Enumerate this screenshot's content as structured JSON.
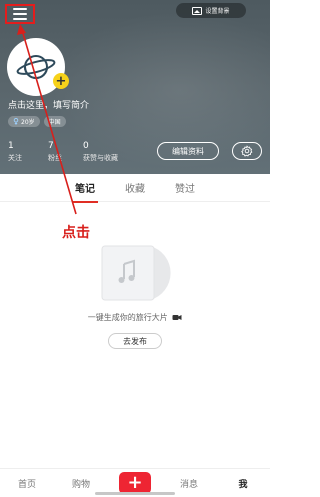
{
  "header": {
    "set_background_label": "设置背景",
    "bio_placeholder": "点击这里，填写简介",
    "tags": [
      {
        "icon": "female-icon",
        "label": "20岁"
      },
      {
        "label": "中国"
      }
    ],
    "stats": [
      {
        "num": "1",
        "label": "关注"
      },
      {
        "num": "7",
        "label": "粉丝"
      },
      {
        "num": "0",
        "label": "获赞与收藏"
      }
    ],
    "edit_profile_label": "编辑资料"
  },
  "tabs": [
    {
      "label": "笔记",
      "active": true
    },
    {
      "label": "收藏",
      "active": false
    },
    {
      "label": "赞过",
      "active": false
    }
  ],
  "annotation": {
    "text": "点击",
    "color": "#d8201c"
  },
  "empty_state": {
    "message": "一键生成你的旅行大片",
    "publish_label": "去发布"
  },
  "bottom_nav": {
    "items": [
      "首页",
      "购物",
      "+",
      "消息",
      "我"
    ],
    "active": "我"
  },
  "colors": {
    "accent": "#ee2533",
    "annotation": "#e41d1d"
  }
}
